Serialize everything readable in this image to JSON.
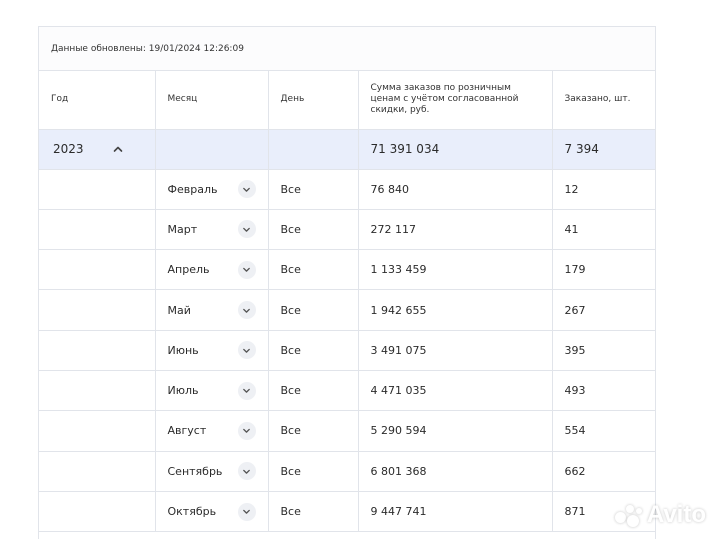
{
  "updated": {
    "label": "Данные обновлены:",
    "value": "19/01/2024 12:26:09"
  },
  "columns": {
    "year": "Год",
    "month": "Месяц",
    "day": "День",
    "sum": "Сумма заказов по розничным ценам с учётом согласованной скидки, руб.",
    "qty": "Заказано, шт."
  },
  "year_row": {
    "year": "2023",
    "sum": "71 391 034",
    "qty": "7 394",
    "expand_icon": "chevron-up-icon"
  },
  "rows": [
    {
      "month": "Февраль",
      "day": "Все",
      "sum": "76 840",
      "qty": "12"
    },
    {
      "month": "Март",
      "day": "Все",
      "sum": "272 117",
      "qty": "41"
    },
    {
      "month": "Апрель",
      "day": "Все",
      "sum": "1 133 459",
      "qty": "179"
    },
    {
      "month": "Май",
      "day": "Все",
      "sum": "1 942 655",
      "qty": "267"
    },
    {
      "month": "Июнь",
      "day": "Все",
      "sum": "3 491 075",
      "qty": "395"
    },
    {
      "month": "Июль",
      "day": "Все",
      "sum": "4 471 035",
      "qty": "493"
    },
    {
      "month": "Август",
      "day": "Все",
      "sum": "5 290 594",
      "qty": "554"
    },
    {
      "month": "Сентябрь",
      "day": "Все",
      "sum": "6 801 368",
      "qty": "662"
    },
    {
      "month": "Октябрь",
      "day": "Все",
      "sum": "9 447 741",
      "qty": "871"
    }
  ],
  "watermark": {
    "text": "Avito"
  },
  "colors": {
    "year_row_bg": "#e9eefb",
    "border": "#e1e4ea",
    "chevron_bg": "#eef0f4"
  }
}
